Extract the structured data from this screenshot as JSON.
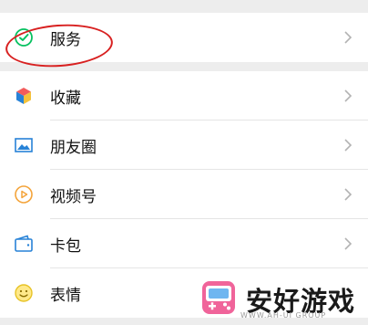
{
  "menu": {
    "service": {
      "label": "服务",
      "icon": "wechat-pay-icon"
    },
    "items": [
      {
        "label": "收藏",
        "icon": "favorites-cube-icon"
      },
      {
        "label": "朋友圈",
        "icon": "moments-image-icon"
      },
      {
        "label": "视频号",
        "icon": "channels-play-icon"
      },
      {
        "label": "卡包",
        "icon": "card-wallet-icon"
      },
      {
        "label": "表情",
        "icon": "sticker-smile-icon"
      }
    ]
  },
  "watermark": {
    "title": "安好游戏",
    "subtitle": "WWW.AH-UI GROUP"
  },
  "colors": {
    "background": "#ededed",
    "annotation": "#d82020",
    "green": "#07c160",
    "blue": "#2782d7",
    "orange": "#f4a43b"
  }
}
